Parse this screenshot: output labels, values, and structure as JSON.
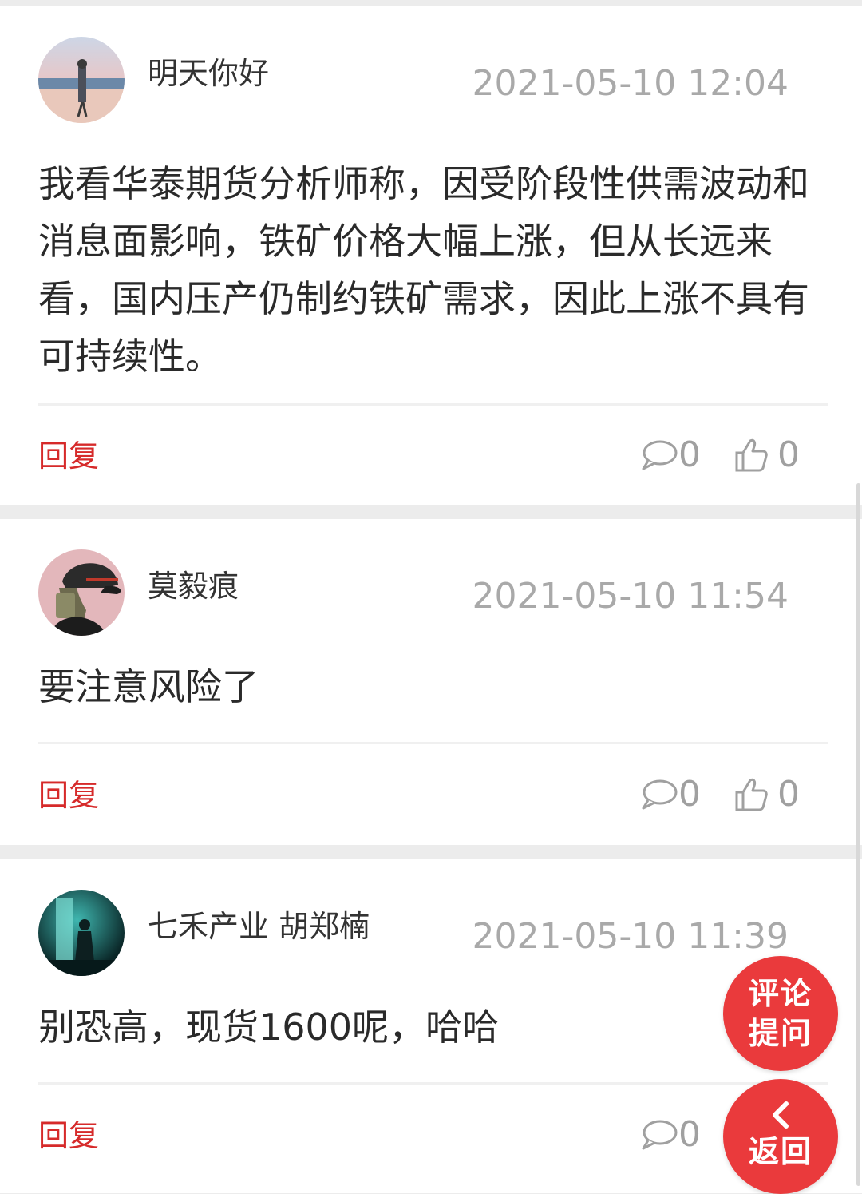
{
  "comments": [
    {
      "username": "明天你好",
      "time": "2021-05-10 12:04",
      "content": "我看华泰期货分析师称，因受阶段性供需波动和消息面影响，铁矿价格大幅上涨，但从长远来看，国内压产仍制约铁矿需求，因此上涨不具有可持续性。",
      "reply_label": "回复",
      "comment_count": "0",
      "like_count": "0"
    },
    {
      "username": "莫毅痕",
      "time": "2021-05-10 11:54",
      "content": "要注意风险了",
      "reply_label": "回复",
      "comment_count": "0",
      "like_count": "0"
    },
    {
      "username": "七禾产业 胡郑楠",
      "time": "2021-05-10 11:39",
      "content": "别恐高，现货1600呢，哈哈",
      "reply_label": "回复",
      "comment_count": "0"
    }
  ],
  "fab": {
    "ask_line1": "评论",
    "ask_line2": "提问",
    "back_label": "返回"
  },
  "colors": {
    "accent": "#ea3a3c",
    "reply_text": "#d62a2a",
    "muted": "#a9a9a9"
  },
  "icons": {
    "comment": "speech-bubble-icon",
    "like": "thumbs-up-icon",
    "back": "chevron-left-icon"
  }
}
